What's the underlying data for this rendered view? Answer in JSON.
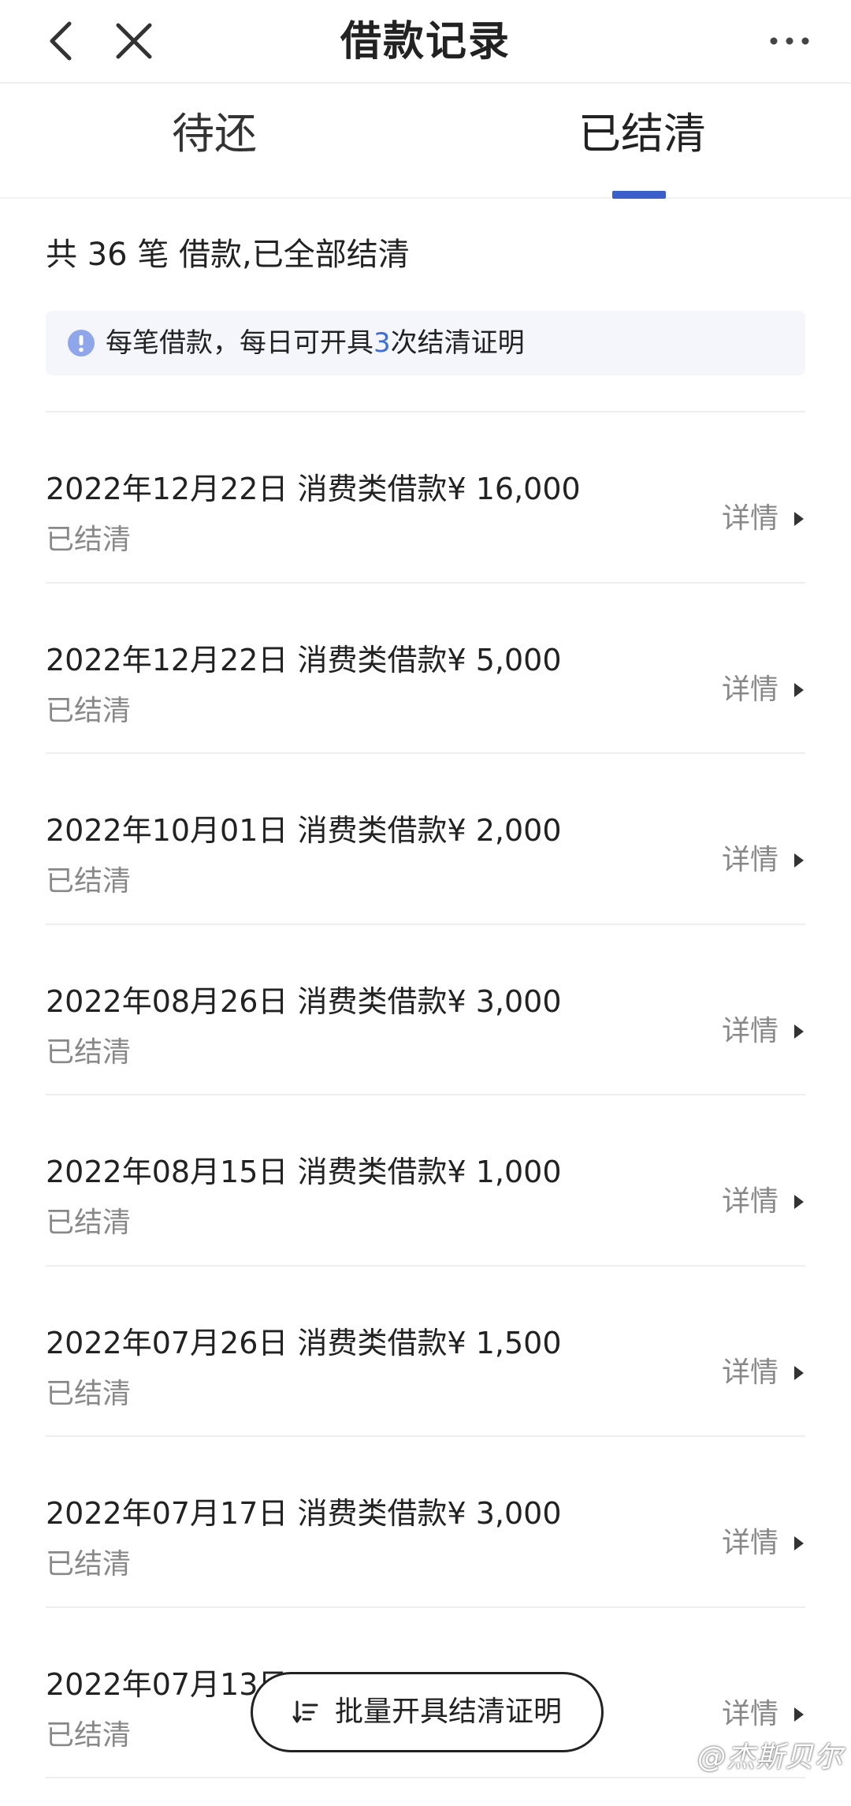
{
  "header": {
    "title": "借款记录",
    "back_icon": "chevron-left-icon",
    "close_icon": "close-icon",
    "more_icon": "more-horizontal-icon"
  },
  "tabs": [
    {
      "label": "待还",
      "active": false
    },
    {
      "label": "已结清",
      "active": true
    }
  ],
  "colors": {
    "accent": "#3a5fc8",
    "notice_bg": "#f4f6fb",
    "info_icon": "#8fa6ea",
    "highlight_number": "#3a6fe0",
    "text_primary": "#222222",
    "text_secondary": "#888888"
  },
  "summary": "共 36 笔 借款,已全部结清",
  "notice": {
    "icon": "info-icon",
    "before": "每笔借款，每日可开具",
    "number": "3",
    "after": "次结清证明"
  },
  "records": [
    {
      "title": "2022年12月22日 消费类借款¥ 16,000",
      "status": "已结清",
      "detail": "详情"
    },
    {
      "title": "2022年12月22日 消费类借款¥ 5,000",
      "status": "已结清",
      "detail": "详情"
    },
    {
      "title": "2022年10月01日 消费类借款¥ 2,000",
      "status": "已结清",
      "detail": "详情"
    },
    {
      "title": "2022年08月26日 消费类借款¥ 3,000",
      "status": "已结清",
      "detail": "详情"
    },
    {
      "title": "2022年08月15日 消费类借款¥ 1,000",
      "status": "已结清",
      "detail": "详情"
    },
    {
      "title": "2022年07月26日 消费类借款¥ 1,500",
      "status": "已结清",
      "detail": "详情"
    },
    {
      "title": "2022年07月17日 消费类借款¥ 3,000",
      "status": "已结清",
      "detail": "详情"
    },
    {
      "title": "2022年07月13日",
      "status": "已结清",
      "detail": "详情"
    }
  ],
  "batch_button": {
    "icon": "sort-icon",
    "label": "批量开具结清证明"
  },
  "watermark": "@杰斯贝尔"
}
